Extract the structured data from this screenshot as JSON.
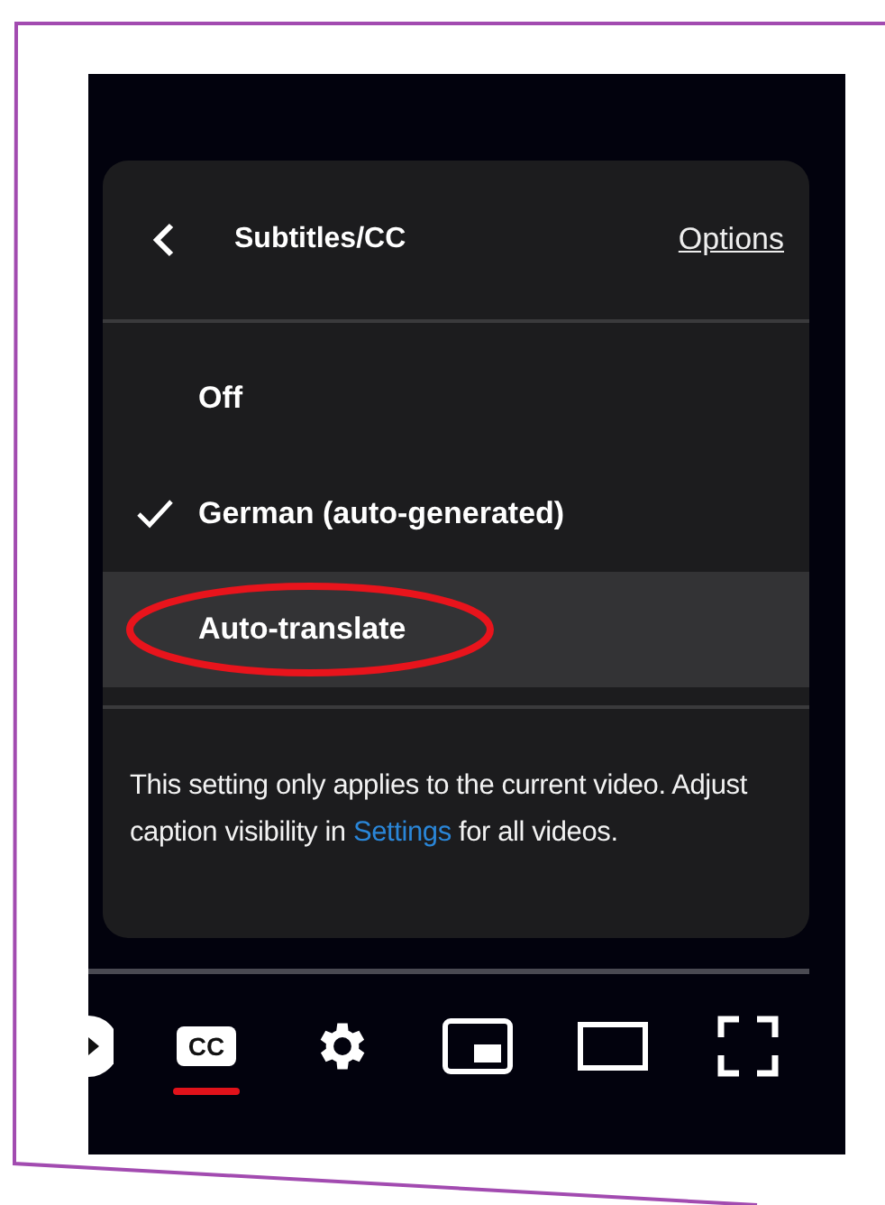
{
  "menu": {
    "title": "Subtitles/CC",
    "options_link": "Options",
    "items": [
      {
        "label": "Off",
        "selected": false,
        "highlighted": false,
        "circled": false
      },
      {
        "label": "German (auto-generated)",
        "selected": true,
        "highlighted": false,
        "circled": false
      },
      {
        "label": "Auto-translate",
        "selected": false,
        "highlighted": true,
        "circled": true
      }
    ],
    "note": {
      "text": "This setting only applies to the current video. Adjust caption visibility in",
      "link": "Settings",
      "text_after": "for all videos."
    }
  },
  "controls": [
    {
      "kind": "play"
    },
    {
      "kind": "cc",
      "label": "CC",
      "active": true
    },
    {
      "kind": "settings"
    },
    {
      "kind": "miniplayer"
    },
    {
      "kind": "theater"
    },
    {
      "kind": "fullscreen"
    }
  ]
}
